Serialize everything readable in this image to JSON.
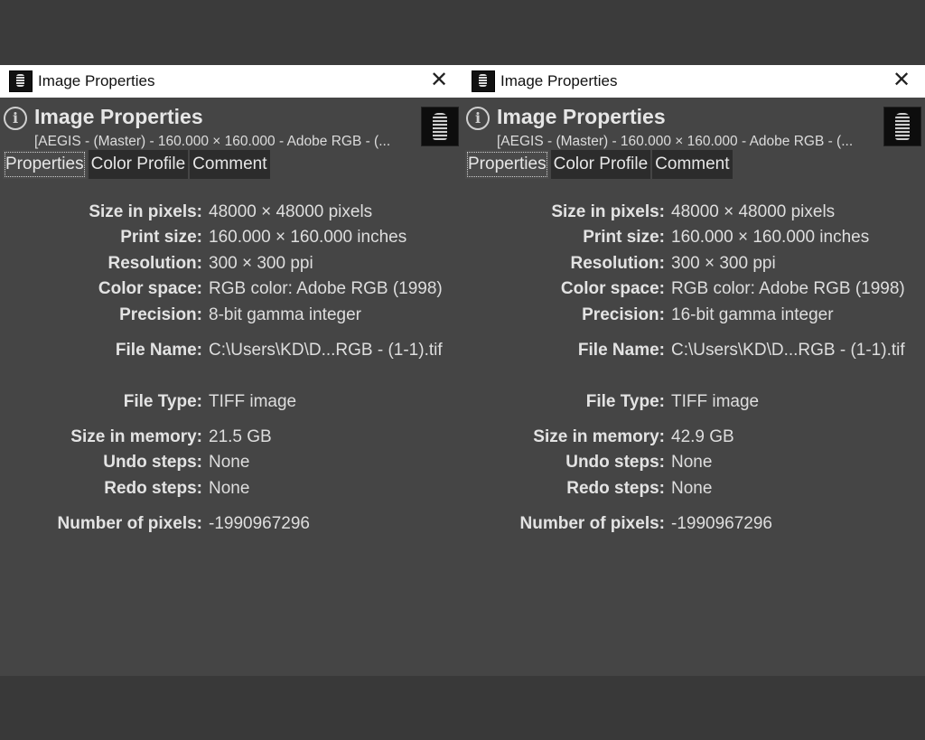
{
  "dialogs": [
    {
      "window_title": "Image Properties",
      "header_title": "Image Properties",
      "header_subtitle": "[AEGIS - (Master) - 160.000 × 160.000 - Adobe RGB - (...",
      "tabs": [
        "Properties",
        "Color Profile",
        "Comment"
      ],
      "properties": [
        {
          "label": "Size in pixels:",
          "value": "48000 × 48000 pixels"
        },
        {
          "label": "Print size:",
          "value": "160.000 × 160.000 inches"
        },
        {
          "label": "Resolution:",
          "value": "300 × 300 ppi"
        },
        {
          "label": "Color space:",
          "value": "RGB color: Adobe RGB (1998)"
        },
        {
          "label": "Precision:",
          "value": "8-bit gamma integer"
        },
        {
          "label": "File Name:",
          "value": "C:\\Users\\KD\\D...RGB - (1-1).tif"
        },
        {
          "label": "File Type:",
          "value": "TIFF image"
        },
        {
          "label": "Size in memory:",
          "value": "21.5 GB"
        },
        {
          "label": "Undo steps:",
          "value": "None"
        },
        {
          "label": "Redo steps:",
          "value": "None"
        },
        {
          "label": "Number of pixels:",
          "value": "-1990967296"
        }
      ]
    },
    {
      "window_title": "Image Properties",
      "header_title": "Image Properties",
      "header_subtitle": "[AEGIS - (Master) - 160.000 × 160.000 - Adobe RGB - (...",
      "tabs": [
        "Properties",
        "Color Profile",
        "Comment"
      ],
      "properties": [
        {
          "label": "Size in pixels:",
          "value": "48000 × 48000 pixels"
        },
        {
          "label": "Print size:",
          "value": "160.000 × 160.000 inches"
        },
        {
          "label": "Resolution:",
          "value": "300 × 300 ppi"
        },
        {
          "label": "Color space:",
          "value": "RGB color: Adobe RGB (1998)"
        },
        {
          "label": "Precision:",
          "value": "16-bit gamma integer"
        },
        {
          "label": "File Name:",
          "value": "C:\\Users\\KD\\D...RGB - (1-1).tif"
        },
        {
          "label": "File Type:",
          "value": "TIFF image"
        },
        {
          "label": "Size in memory:",
          "value": "42.9 GB"
        },
        {
          "label": "Undo steps:",
          "value": "None"
        },
        {
          "label": "Redo steps:",
          "value": "None"
        },
        {
          "label": "Number of pixels:",
          "value": "-1990967296"
        }
      ]
    }
  ],
  "icons": {
    "close": "close-icon",
    "info": "info-icon",
    "app": "gimp-image-icon",
    "thumbnail": "image-thumbnail"
  },
  "colors": {
    "background": "#3b3b3b",
    "panel": "#454545",
    "titlebar": "#ffffff",
    "tab_inactive": "#2c2c2c"
  }
}
